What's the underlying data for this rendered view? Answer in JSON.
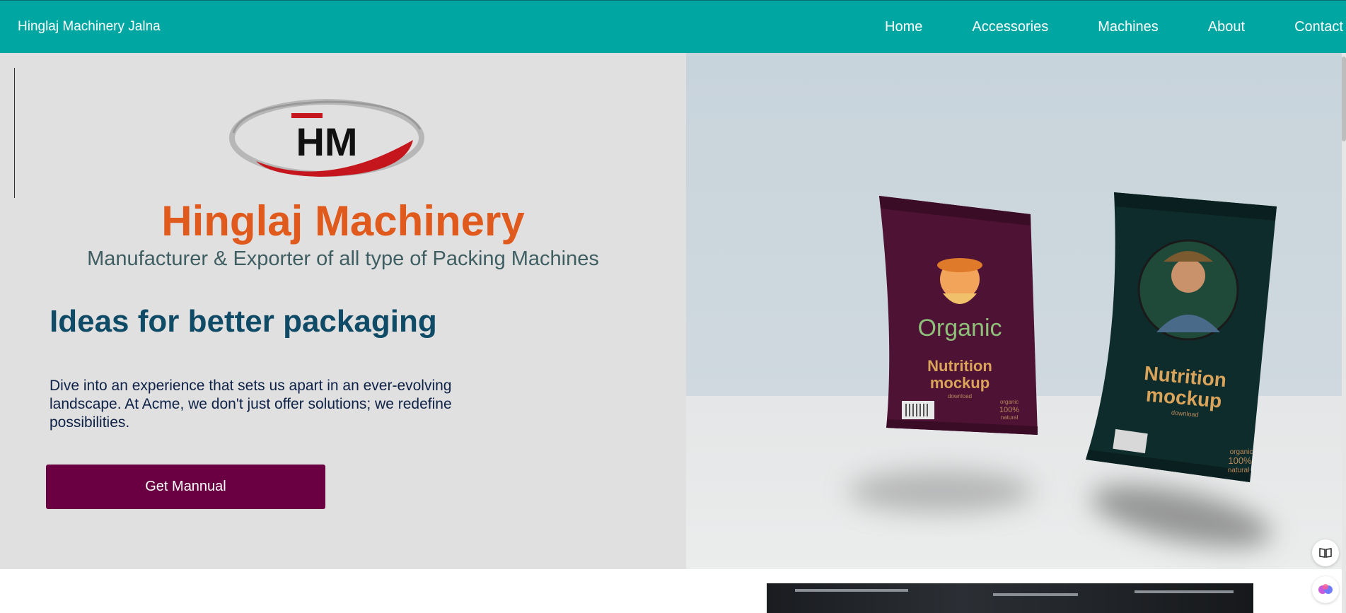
{
  "nav": {
    "brand": "Hinglaj Machinery Jalna",
    "links": [
      "Home",
      "Accessories",
      "Machines",
      "About",
      "Contact"
    ]
  },
  "hero": {
    "logo_text": "HM",
    "title": "Hinglaj Machinery",
    "subtitle": "Manufacturer & Exporter of all type of Packing Machines",
    "headline": "Ideas for better packaging",
    "description": "Dive into an experience that sets us apart in an ever-evolving landscape. At Acme, we don't just offer solutions; we redefine possibilities.",
    "cta_label": "Get Mannual"
  },
  "mockup": {
    "bag1": {
      "brand": "Organic",
      "line1": "Nutrition",
      "line2": "mockup",
      "small": "download",
      "badge1": "organic",
      "badge2": "100%",
      "badge3": "natural"
    },
    "bag2": {
      "line1": "Nutrition",
      "line2": "mockup",
      "small": "download",
      "badge1": "organic",
      "badge2": "100%",
      "badge3": "natural"
    }
  },
  "icons": {
    "reader": "book-icon",
    "assistant": "brain-icon"
  },
  "colors": {
    "navbar": "#00a7a2",
    "title": "#e15a1d",
    "headline": "#0f4b66",
    "cta": "#6a0042"
  }
}
